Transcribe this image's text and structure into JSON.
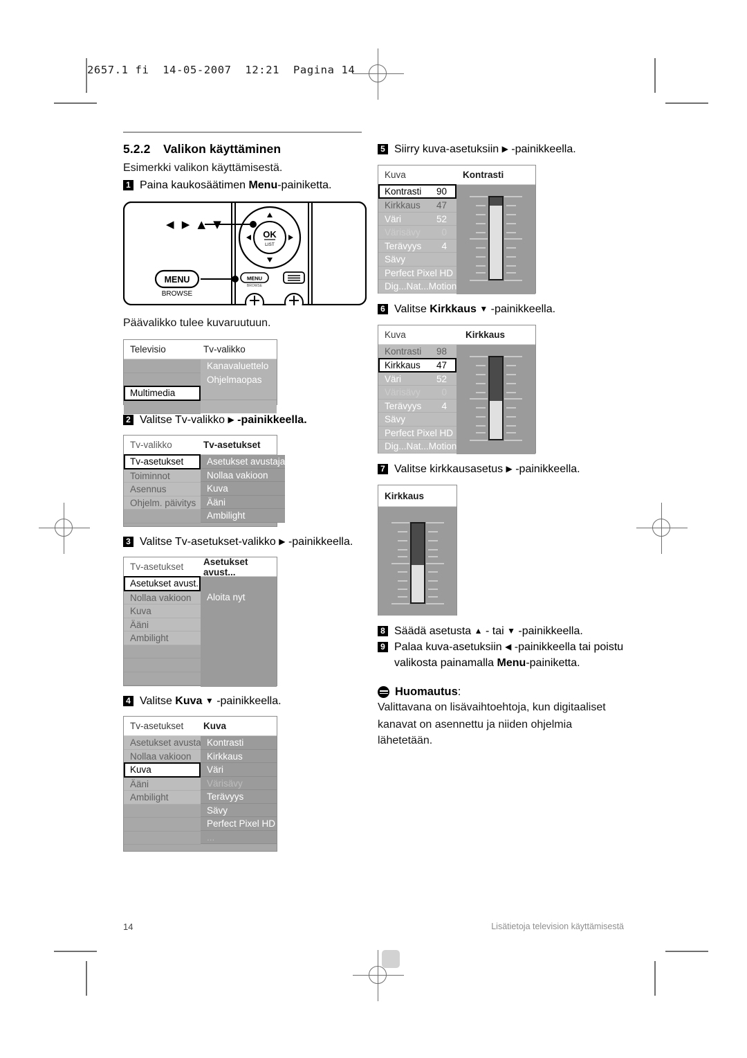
{
  "print_slug": "2657.1 fi  14-05-2007  12:21  Pagina 14",
  "section": {
    "number": "5.2.2",
    "title": "Valikon käyttäminen",
    "intro": "Esimerkki valikon käyttämisestä."
  },
  "steps": {
    "s1": {
      "badge": "1",
      "pre": "Paina kaukosäätimen ",
      "bold": "Menu",
      "post": "-painiketta."
    },
    "s2": {
      "badge": "2",
      "pre": "Valitse Tv-valikko ",
      "arrow": "▶",
      "post": " -painikkeella.",
      "post_bold": "-painikkeella."
    },
    "s3": {
      "badge": "3",
      "pre": "Valitse Tv-asetukset-valikko ",
      "arrow": "▶",
      "post": " -painikkeella."
    },
    "s4": {
      "badge": "4",
      "pre": "Valitse ",
      "bold": "Kuva",
      "arrow": "▼",
      "post": " -painikkeella."
    },
    "s5": {
      "badge": "5",
      "pre": "Siirry kuva-asetuksiin ",
      "arrow": "▶",
      "post": " -painikkeella."
    },
    "s6": {
      "badge": "6",
      "pre": "Valitse ",
      "bold": "Kirkkaus",
      "arrow": "▼",
      "post": " -painikkeella."
    },
    "s7": {
      "badge": "7",
      "pre": "Valitse kirkkausasetus ",
      "arrow": "▶",
      "post": " -painikkeella."
    },
    "s8": {
      "badge": "8",
      "pre": "Säädä asetusta ",
      "arrow1": "▲",
      "mid": " - tai ",
      "arrow2": "▼",
      "post": " -painikkeella."
    },
    "s9": {
      "badge": "9",
      "pre": "Palaa kuva-asetuksiin ",
      "arrow": "◀",
      "post": " -painikkeella tai poistu",
      "line2_pre": "valikosta painamalla ",
      "line2_bold": "Menu",
      "line2_post": "-painiketta."
    }
  },
  "caption_main_menu": "Päävalikko tulee kuvaruutuun.",
  "remote": {
    "cursor_glyphs": "◀ ▶ ▲ ▼",
    "menu_button_label": "MENU",
    "menu_button_sub": "BROWSE",
    "ok_label": "OK",
    "ok_sub": "LIST",
    "remote_menu_label": "MENU",
    "remote_menu_sub": "BROWSE"
  },
  "menus": {
    "main": {
      "header_left": "Televisio",
      "header_right": "",
      "left_items": [
        "Televisio",
        "Multimedia"
      ],
      "right_items": [
        "Tv-valikko",
        "Kanavaluettelo",
        "Ohjelmaopas"
      ],
      "selected_left": "Multimedia"
    },
    "tvvalikko": {
      "header_left": "Tv-valikko",
      "header_right": "Tv-asetukset",
      "left_items": [
        "Tv-asetukset",
        "Toiminnot",
        "Asennus",
        "Ohjelm. päivitys"
      ],
      "right_items": [
        "Asetukset avustaja",
        "Nollaa vakioon",
        "Kuva",
        "Ääni",
        "Ambilight"
      ],
      "selected_left": "Tv-asetukset"
    },
    "tvasetukset": {
      "header_left": "Tv-asetukset",
      "header_right": "Asetukset avust...",
      "left_items": [
        "Asetukset avust...",
        "Nollaa vakioon",
        "Kuva",
        "Ääni",
        "Ambilight"
      ],
      "right_items": [
        "Aloita nyt"
      ],
      "selected_left": "Asetukset avust..."
    },
    "kuva": {
      "header_left": "Tv-asetukset",
      "header_right": "Kuva",
      "left_items": [
        "Asetukset avustaja",
        "Nollaa vakioon",
        "Kuva",
        "Ääni",
        "Ambilight"
      ],
      "right_items": [
        "Kontrasti",
        "Kirkkaus",
        "Väri",
        "Värisävy",
        "Terävyys",
        "Sävy",
        "Perfect Pixel HD",
        "..."
      ],
      "dim_right": [
        "Värisävy"
      ],
      "selected_left": "Kuva"
    },
    "kontrasti": {
      "header_left": "Kuva",
      "header_right": "Kontrasti",
      "rows": [
        {
          "label": "Kontrasti",
          "value": "90",
          "selected": true,
          "dim": false
        },
        {
          "label": "Kirkkaus",
          "value": "47",
          "selected": false,
          "dim": false
        },
        {
          "label": "Väri",
          "value": "52",
          "selected": false,
          "dim": false
        },
        {
          "label": "Värisävy",
          "value": "0",
          "selected": false,
          "dim": true
        },
        {
          "label": "Terävyys",
          "value": "4",
          "selected": false,
          "dim": false
        },
        {
          "label": "Sävy",
          "value": "",
          "selected": false,
          "dim": false
        },
        {
          "label": "Perfect Pixel HD",
          "value": "",
          "selected": false,
          "dim": false
        },
        {
          "label": "Dig...Nat...Motion",
          "value": "",
          "selected": false,
          "dim": false
        }
      ],
      "slider_percent": 90
    },
    "kirkkaus": {
      "header_left": "Kuva",
      "header_right": "Kirkkaus",
      "rows": [
        {
          "label": "Kontrasti",
          "value": "98",
          "selected": false,
          "dim": false
        },
        {
          "label": "Kirkkaus",
          "value": "47",
          "selected": true,
          "dim": false
        },
        {
          "label": "Väri",
          "value": "52",
          "selected": false,
          "dim": false
        },
        {
          "label": "Värisävy",
          "value": "0",
          "selected": false,
          "dim": true
        },
        {
          "label": "Terävyys",
          "value": "4",
          "selected": false,
          "dim": false
        },
        {
          "label": "Sävy",
          "value": "",
          "selected": false,
          "dim": false
        },
        {
          "label": "Perfect Pixel HD",
          "value": "",
          "selected": false,
          "dim": false
        },
        {
          "label": "Dig...Nat...Motion",
          "value": "",
          "selected": false,
          "dim": false
        }
      ],
      "slider_percent": 47
    },
    "kirkkaus_single": {
      "header": "Kirkkaus",
      "slider_percent": 47
    }
  },
  "note": {
    "label": "Huomautus",
    "colon": ":",
    "line1": "Valittavana on lisävaihtoehtoja, kun digitaaliset",
    "line2": "kanavat on asennettu ja niiden ohjelmia lähetetään."
  },
  "footer": {
    "page_number": "14",
    "running_head": "Lisätietoja television käyttämisestä"
  }
}
